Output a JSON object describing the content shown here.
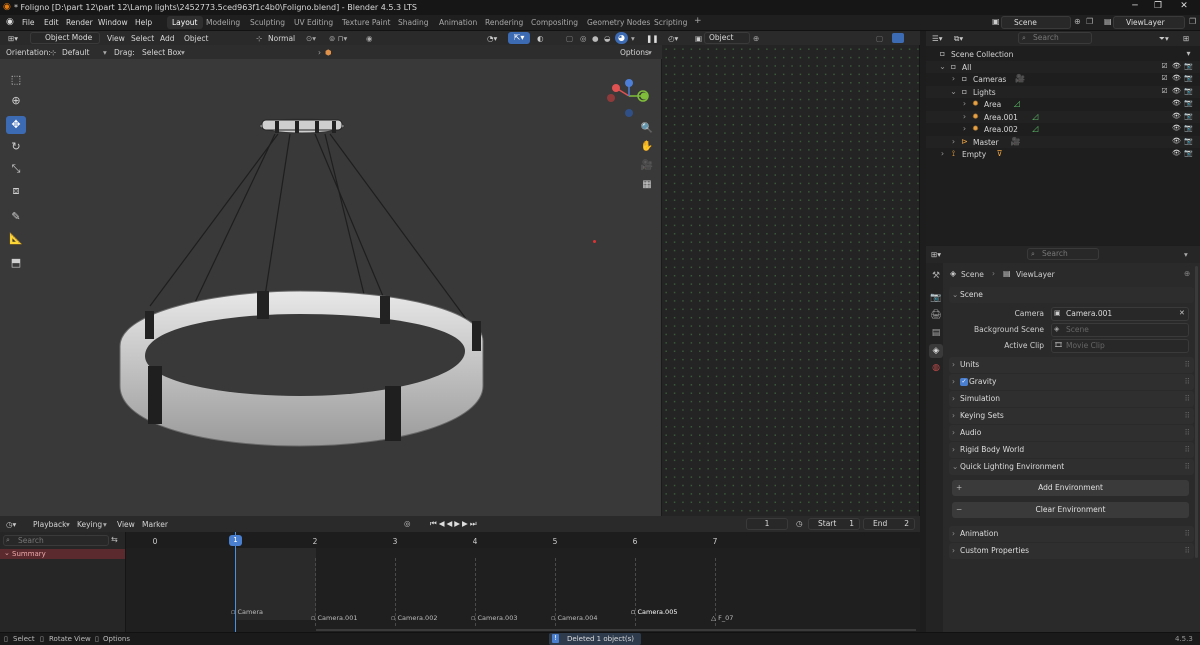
{
  "window": {
    "title": "* Foligno [D:\\part 12\\part 12\\Lamp lights\\2452773.5ced963f1c4b0\\Foligno.blend] - Blender 4.5.3 LTS"
  },
  "menus": [
    "File",
    "Edit",
    "Render",
    "Window",
    "Help"
  ],
  "workspaces": [
    "Layout",
    "Modeling",
    "Sculpting",
    "UV Editing",
    "Texture Paint",
    "Shading",
    "Animation",
    "Rendering",
    "Compositing",
    "Geometry Nodes",
    "Scripting"
  ],
  "active_workspace": "Layout",
  "top_right": {
    "scene": "Scene",
    "view_layer": "ViewLayer"
  },
  "viewport": {
    "mode": "Object Mode",
    "menus": [
      "View",
      "Select",
      "Add",
      "Object"
    ],
    "transform_pivot": "Normal",
    "orientation_label": "Orientation:",
    "orientation_value": "Default",
    "drag_label": "Drag:",
    "drag_value": "Select Box",
    "options": "Options"
  },
  "dopesheet": {
    "mode": "Object"
  },
  "outliner": {
    "search_placeholder": "Search",
    "rows": [
      {
        "label": "Scene Collection",
        "indent": 0,
        "icon": "collection-icon"
      },
      {
        "label": "All",
        "indent": 1,
        "icon": "collection-icon"
      },
      {
        "label": "Cameras",
        "indent": 2,
        "icon": "collection-icon"
      },
      {
        "label": "Lights",
        "indent": 2,
        "icon": "collection-icon"
      },
      {
        "label": "Area",
        "indent": 3,
        "icon": "light-icon"
      },
      {
        "label": "Area.001",
        "indent": 3,
        "icon": "light-icon"
      },
      {
        "label": "Area.002",
        "indent": 3,
        "icon": "light-icon"
      },
      {
        "label": "Master",
        "indent": 2,
        "icon": "object-icon"
      },
      {
        "label": "Empty",
        "indent": 1,
        "icon": "empty-icon"
      }
    ]
  },
  "properties": {
    "search_placeholder": "Search",
    "breadcrumb": [
      "Scene",
      "ViewLayer"
    ],
    "scene_panel": "Scene",
    "camera_label": "Camera",
    "camera_value": "Camera.001",
    "background_label": "Background Scene",
    "background_placeholder": "Scene",
    "clip_label": "Active Clip",
    "clip_placeholder": "Movie Clip",
    "panels_mid": [
      "Units",
      "Gravity",
      "Simulation",
      "Keying Sets",
      "Audio",
      "Rigid Body World",
      "Quick Lighting Environment"
    ],
    "add_env": "Add Environment",
    "clear_env": "Clear Environment",
    "panels_bottom": [
      "Animation",
      "Custom Properties"
    ]
  },
  "timeline": {
    "menus": [
      "Playback",
      "Keying",
      "View",
      "Marker"
    ],
    "current_frame": "1",
    "start_label": "Start",
    "start": "1",
    "end_label": "End",
    "end": "2",
    "search_placeholder": "Search",
    "summary": "Summary",
    "frames": [
      "0",
      "1",
      "2",
      "3",
      "4",
      "5",
      "6",
      "7"
    ],
    "markers": [
      "Camera",
      "Camera.001",
      "Camera.002",
      "Camera.003",
      "Camera.004",
      "Camera.005",
      "F_07"
    ]
  },
  "status": {
    "select": "Select",
    "rotate": "Rotate View",
    "options": "Options",
    "message": "Deleted 1 object(s)",
    "version": "4.5.3"
  }
}
